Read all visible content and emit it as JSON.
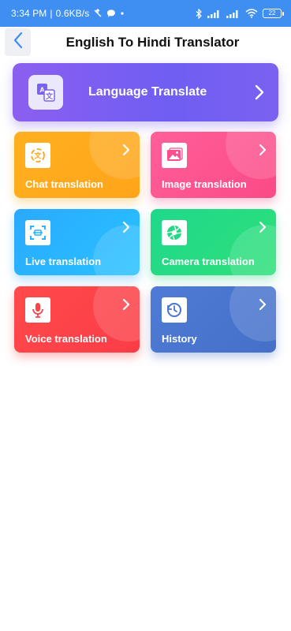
{
  "status_bar": {
    "time": "3:34 PM",
    "separator": "|",
    "speed": "0.6KB/s",
    "battery": "22",
    "icons": [
      "no-data-icon",
      "chat-bubble-icon",
      "dot-icon",
      "bluetooth-icon",
      "signal-icon",
      "signal-icon",
      "wifi-icon",
      "battery-icon"
    ]
  },
  "header": {
    "title": "English To Hindi Translator",
    "back_icon": "chevron-left-icon"
  },
  "banner": {
    "label": "Language Translate",
    "icon": "translate-icon",
    "chevron": "chevron-right-icon"
  },
  "cards": [
    {
      "label": "Chat translation",
      "icon": "chat-translate-icon",
      "accent": "#ffa61c"
    },
    {
      "label": "Image translation",
      "icon": "image-icon",
      "accent": "#fc4f8b"
    },
    {
      "label": "Live translation",
      "icon": "scan-icon",
      "accent": "#29b4ff"
    },
    {
      "label": "Camera translation",
      "icon": "aperture-icon",
      "accent": "#25d885"
    },
    {
      "label": "Voice translation",
      "icon": "microphone-icon",
      "accent": "#fd4347"
    },
    {
      "label": "History",
      "icon": "history-icon",
      "accent": "#4a74cf"
    }
  ],
  "colors": {
    "status_bar": "#3f8ef2",
    "banner": "#7b61f0",
    "title": "#111111"
  }
}
